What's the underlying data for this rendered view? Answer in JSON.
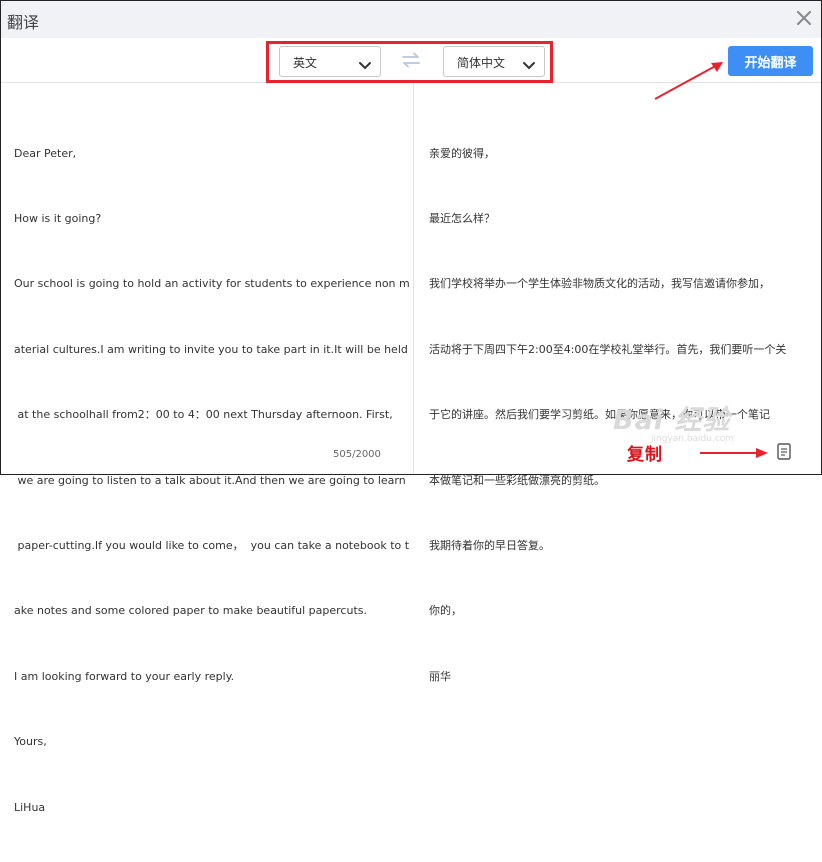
{
  "window": {
    "title": "翻译"
  },
  "toolbar": {
    "source_lang": "英文",
    "target_lang": "简体中文",
    "start_label": "开始翻译"
  },
  "source": {
    "lines": [
      "Dear Peter,",
      "How is it going?",
      "Our school is going to hold an activity for students to experience non m",
      "aterial cultures.I am writing to invite you to take part in it.It will be held",
      " at the schoolhall from2：00 to 4：00 next Thursday afternoon. First,",
      " we are going to listen to a talk about it.And then we are going to learn",
      " paper-cutting.If you would like to come，  you can take a notebook to t",
      "ake notes and some colored paper to make beautiful papercuts.",
      "I am looking forward to your early reply.",
      "Yours,",
      "LiHua"
    ],
    "char_count": "505/2000"
  },
  "target": {
    "lines": [
      "亲爱的彼得，",
      "最近怎么样？",
      "我们学校将举办一个学生体验非物质文化的活动，我写信邀请你参加，",
      "活动将于下周四下午2:00至4:00在学校礼堂举行。首先，我们要听一个关",
      "于它的讲座。然后我们要学习剪纸。如果你愿意来，你可以带一个笔记",
      "本做笔记和一些彩纸做漂亮的剪纸。",
      "我期待着你的早日答复。",
      "你的，",
      "丽华"
    ]
  },
  "annotation": {
    "copy_label": "复制"
  },
  "watermark": {
    "logo_text": "Bai 经验",
    "url_text": "jingyan.baidu.com"
  },
  "colors": {
    "accent": "#3d8ff5",
    "highlight": "#e8232d",
    "annotation": "#d9141c"
  },
  "icons": {
    "close": "close-icon",
    "swap": "swap-arrows-icon",
    "copy": "copy-icon"
  }
}
